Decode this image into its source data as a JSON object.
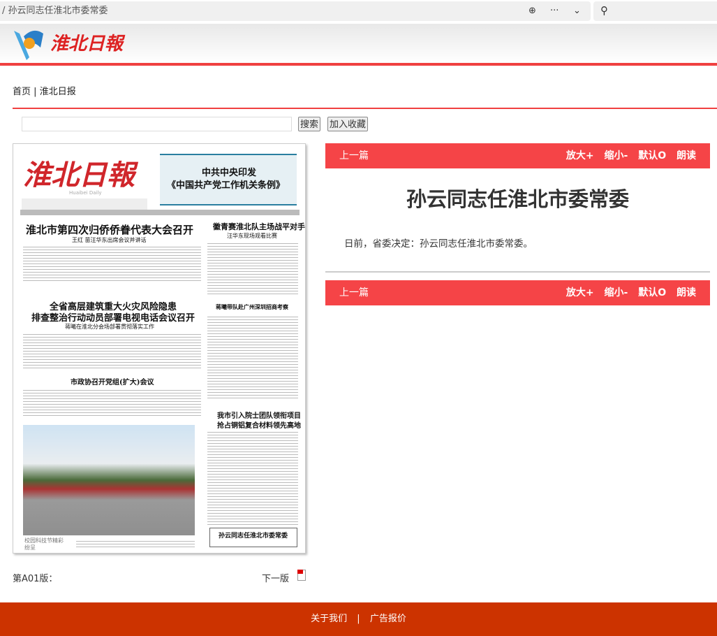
{
  "browser": {
    "address": "/ 孙云同志任淮北市委常委"
  },
  "header": {
    "logo_text": "淮北日報"
  },
  "breadcrumb": {
    "home": "首页",
    "sep": "|",
    "section": "淮北日报"
  },
  "search": {
    "placeholder": "",
    "button": "搜索",
    "favorite": "加入收藏"
  },
  "newspaper_page": {
    "masthead": "淮北日報",
    "masthead_en": "Huaibei Daily",
    "top_box_line1": "中共中央印发",
    "top_box_line2": "《中国共产党工作机关条例》",
    "headline1": "淮北市第四次归侨侨眷代表大会召开",
    "sub1": "王红 苗汪华东出席会议并讲话",
    "headline2": "徽青赛淮北队主场战平对手",
    "sub2": "汪华东现场观看比赛",
    "headline3a": "全省高层建筑重大火灾风险隐患",
    "headline3b": "排查整治行动动员部署电视电话会议召开",
    "sub3": "蒋曦在淮北分会场部署贯彻落实工作",
    "headline4": "蒋曦带队赴广州深圳招商考察",
    "headline5": "市政协召开党组(扩大)会议",
    "headline6a": "我市引入院士团队领衔项目",
    "headline6b": "抢占铜铝复合材料领先高地",
    "photo_caption": "校园科技节精彩纷呈",
    "box_title": "孙云同志任淮北市委常委"
  },
  "article": {
    "prev": "上一篇",
    "zoom_in": "放大+",
    "zoom_out": "缩小-",
    "default": "默认O",
    "read": "朗读",
    "title": "孙云同志任淮北市委常委",
    "body": "日前，省委决定：孙云同志任淮北市委常委。"
  },
  "page_nav": {
    "edition": "第A01版：",
    "next": "下一版"
  },
  "footer": {
    "about": "关于我们",
    "sep": "|",
    "ads": "广告报价"
  },
  "colors": {
    "accent": "#f54447",
    "footer": "#cc3300"
  }
}
